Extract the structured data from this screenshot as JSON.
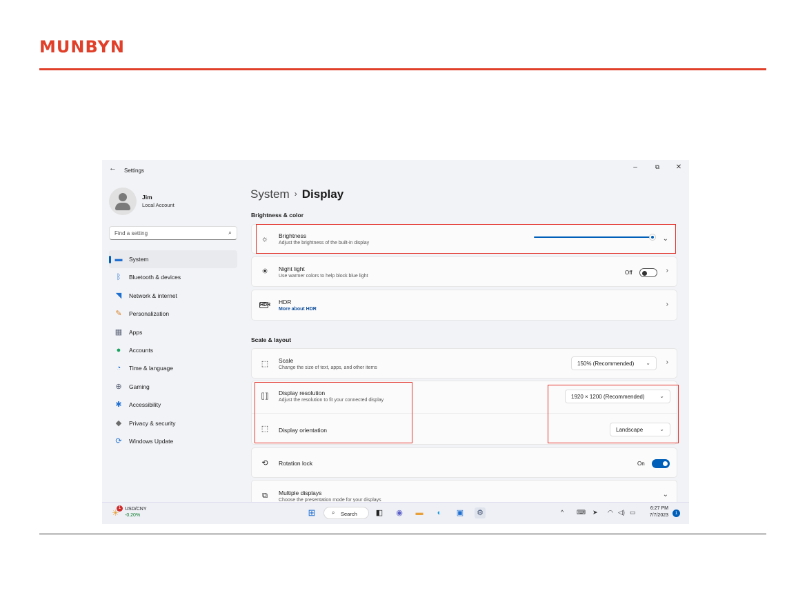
{
  "brand": {
    "logo_text": "MUNBYN",
    "color": "#e0402a"
  },
  "window": {
    "app_title": "Settings",
    "back_icon": "arrow-left-icon",
    "controls": {
      "minimize": "–",
      "restore": "⧉",
      "close": "✕"
    }
  },
  "profile": {
    "name": "Jim",
    "account_type": "Local Account"
  },
  "search": {
    "placeholder": "Find a setting",
    "icon": "search-icon"
  },
  "sidebar": {
    "items": [
      {
        "label": "System",
        "icon": "monitor-icon",
        "glyph": "▬",
        "color": "#1f6fd1",
        "active": true
      },
      {
        "label": "Bluetooth & devices",
        "icon": "bluetooth-icon",
        "glyph": "ᛒ",
        "color": "#1f6fd1"
      },
      {
        "label": "Network & internet",
        "icon": "wifi-icon",
        "glyph": "◥",
        "color": "#1f6fd1"
      },
      {
        "label": "Personalization",
        "icon": "brush-icon",
        "glyph": "✎",
        "color": "#d9822b"
      },
      {
        "label": "Apps",
        "icon": "apps-icon",
        "glyph": "▦",
        "color": "#5b6478"
      },
      {
        "label": "Accounts",
        "icon": "person-icon",
        "glyph": "●",
        "color": "#18a35e"
      },
      {
        "label": "Time & language",
        "icon": "globe-clock-icon",
        "glyph": "◔",
        "color": "#1f6fd1"
      },
      {
        "label": "Gaming",
        "icon": "gamepad-icon",
        "glyph": "⊕",
        "color": "#5b6478"
      },
      {
        "label": "Accessibility",
        "icon": "accessibility-icon",
        "glyph": "✱",
        "color": "#1f6fd1"
      },
      {
        "label": "Privacy & security",
        "icon": "shield-icon",
        "glyph": "◆",
        "color": "#6b6b6b"
      },
      {
        "label": "Windows Update",
        "icon": "sync-icon",
        "glyph": "⟳",
        "color": "#1f6fd1"
      }
    ]
  },
  "breadcrumb": {
    "parent": "System",
    "separator": "›",
    "current": "Display"
  },
  "sections": {
    "brightness_color": "Brightness & color",
    "scale_layout": "Scale & layout"
  },
  "settings": {
    "brightness": {
      "title": "Brightness",
      "subtitle": "Adjust the brightness of the built-in display",
      "level": 1.0
    },
    "night_light": {
      "title": "Night light",
      "subtitle": "Use warmer colors to help block blue light",
      "state": "Off"
    },
    "hdr": {
      "title": "HDR",
      "link": "More about HDR"
    },
    "scale": {
      "title": "Scale",
      "subtitle": "Change the size of text, apps, and other items",
      "value": "150% (Recommended)"
    },
    "resolution": {
      "title": "Display resolution",
      "subtitle": "Adjust the resolution to fit your connected display",
      "value": "1920 × 1200 (Recommended)"
    },
    "orientation": {
      "title": "Display orientation",
      "value": "Landscape"
    },
    "rotation_lock": {
      "title": "Rotation lock",
      "state": "On"
    },
    "multiple_displays": {
      "title": "Multiple displays",
      "subtitle": "Choose the presentation mode for your displays"
    }
  },
  "taskbar": {
    "widget": {
      "badge": "1",
      "ticker": "USD/CNY",
      "change": "-0.20%"
    },
    "search_label": "Search",
    "time": "6:27 PM",
    "date": "7/7/2023",
    "notification_count": "1"
  },
  "colors": {
    "accent": "#005fb8",
    "highlight_box": "#e3332c"
  }
}
